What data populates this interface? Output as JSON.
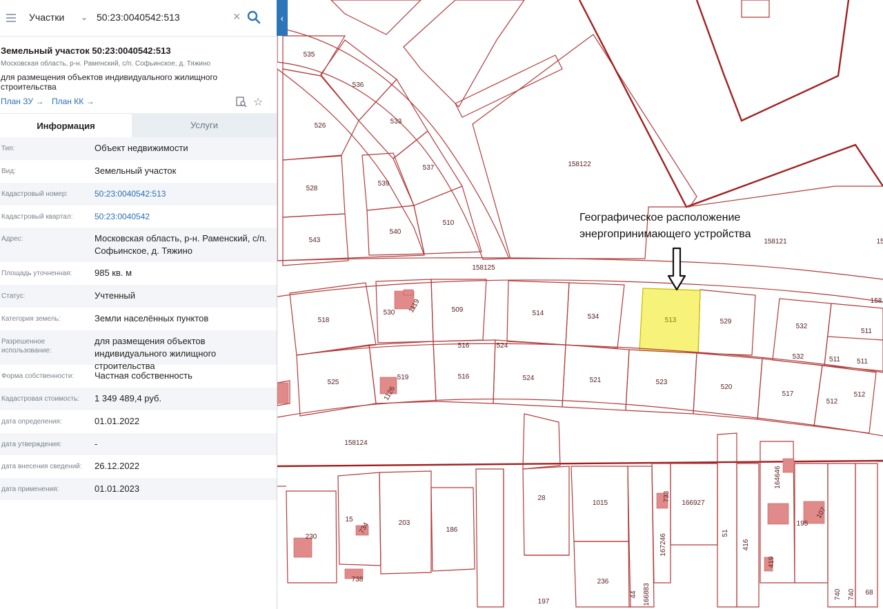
{
  "search": {
    "type_label": "Участки",
    "query": "50:23:0040542:513"
  },
  "object": {
    "title": "Земельный участок 50:23:0040542:513",
    "address_line": "Московская область, р-н. Раменский, с/п. Софьинское, д. Тяжино",
    "usage": "для размещения объектов индивидуального жилищного строительства",
    "links": [
      "План ЗУ →",
      "План КК →"
    ]
  },
  "tabs": [
    "Информация",
    "Услуги"
  ],
  "info_rows": [
    {
      "key": "Тип:",
      "value": "Объект недвижимости"
    },
    {
      "key": "Вид:",
      "value": "Земельный участок"
    },
    {
      "key": "Кадастровый номер:",
      "value": "50:23:0040542:513",
      "link": true
    },
    {
      "key": "Кадастровый квартал:",
      "value": "50:23:0040542",
      "link": true
    },
    {
      "key": "Адрес:",
      "value": "Московская область, р-н. Раменский, с/п. Софьинское, д. Тяжино"
    },
    {
      "key": "Площадь уточненная:",
      "value": "985 кв. м"
    },
    {
      "key": "Статус:",
      "value": "Учтенный"
    },
    {
      "key": "Категория земель:",
      "value": "Земли населённых пунктов"
    },
    {
      "key": "Разрешенное использование:",
      "value": "для размещения объектов индивидуального жилищного строительства"
    },
    {
      "key": "Форма собственности:",
      "value": "Частная собственность"
    },
    {
      "key": "Кадастровая стоимость:",
      "value": "1 349 489,4 руб."
    },
    {
      "key": "дата определения:",
      "value": "01.01.2022"
    },
    {
      "key": "дата утверждения:",
      "value": "-"
    },
    {
      "key": "дата внесения сведений:",
      "value": "26.12.2022"
    },
    {
      "key": "дата применения:",
      "value": "01.01.2023"
    }
  ],
  "map": {
    "annotation": [
      "Географическое расположение",
      "энергопринимающего устройства"
    ],
    "highlight_color": "#f7f37a",
    "boundary_color": "#b23a3a",
    "plot_labels": [
      "535",
      "536",
      "526",
      "533",
      "537",
      "539",
      "528",
      "543",
      "540",
      "510",
      "158122",
      "158121",
      "158125",
      "518",
      "530",
      "509",
      "514",
      "534",
      "513",
      "529",
      "532",
      "511",
      "511",
      "511",
      "532",
      "158",
      "516",
      "524",
      "525",
      "519",
      "516",
      "524",
      "521",
      "523",
      "520",
      "517",
      "512",
      "512",
      "158124",
      "28",
      "1015",
      "166927",
      "733",
      "164646",
      "195",
      "230",
      "15",
      "203",
      "186",
      "734",
      "738",
      "236",
      "167246",
      "51",
      "416",
      "419",
      "197",
      "44",
      "166883",
      "740",
      "740",
      "68",
      "1119",
      "1126",
      "15"
    ]
  }
}
